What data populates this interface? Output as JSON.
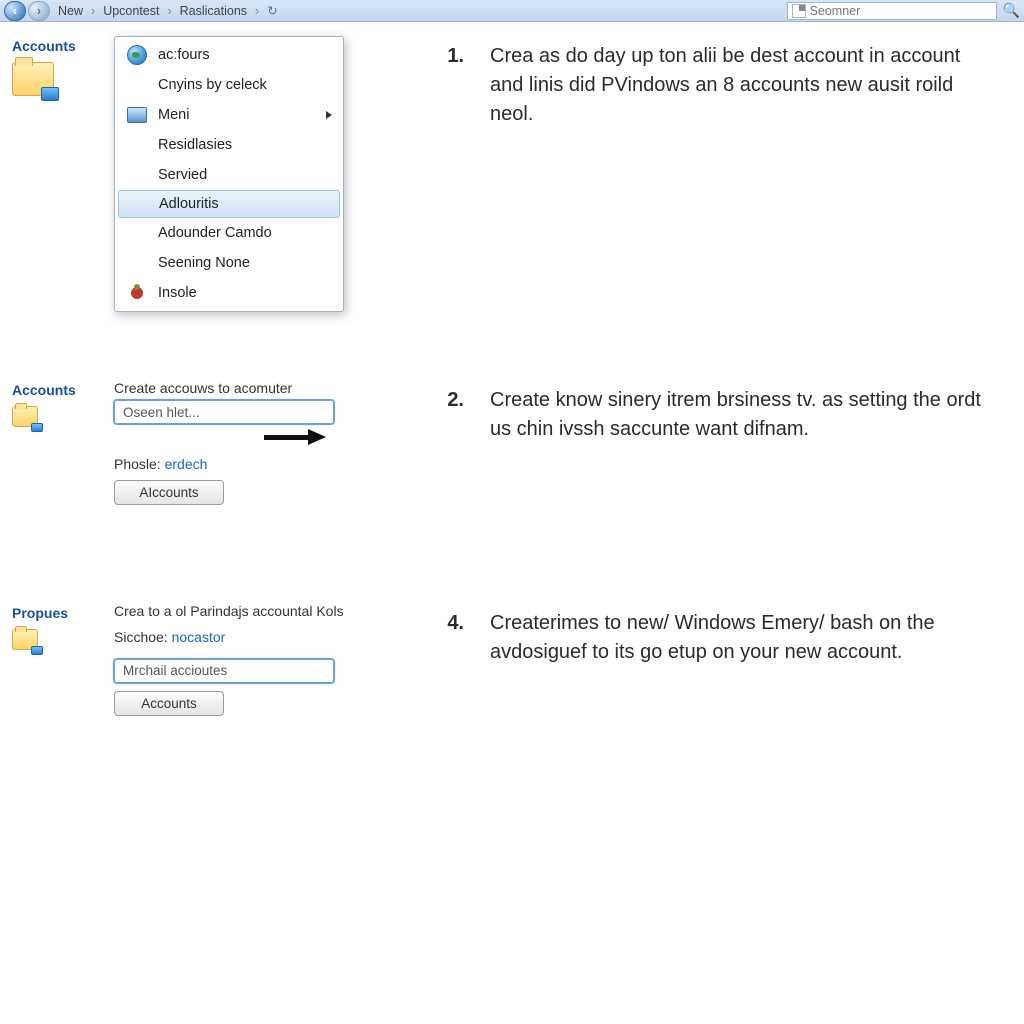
{
  "titlebar": {
    "crumbs": [
      "New",
      "Upcontest",
      "Raslications"
    ],
    "search_placeholder": "Seomner"
  },
  "step1": {
    "sidebar_caption": "Accounts",
    "menu": [
      {
        "label": "acːfours",
        "icon": "globe"
      },
      {
        "label": "Cnyins by celeck",
        "icon": ""
      },
      {
        "label": "Meni",
        "icon": "app",
        "submenu": true
      },
      {
        "label": "Residlasies",
        "icon": ""
      },
      {
        "label": "Servied",
        "icon": ""
      },
      {
        "label": "Adlouritis",
        "icon": "",
        "hover": true
      },
      {
        "label": "Adounder Camdo",
        "icon": ""
      },
      {
        "label": "Seening None",
        "icon": ""
      },
      {
        "label": "Insole",
        "icon": "bug"
      }
    ],
    "num": "1.",
    "text": "Crea as do day up ton alii be dest account in account and linis did PVindows an 8 accounts new ausit roild neol."
  },
  "step2": {
    "sidebar_caption": "Accounts",
    "heading": "Create accouws to acomuter",
    "input_value": "Oseen hlet...",
    "phosle_label": "Phosle:",
    "phosle_value": "erdech",
    "button": "AIccounts",
    "num": "2.",
    "text": "Create know sinery itrem brsiness tv. as setting the ordt us chin ivssh saccunte want difnam."
  },
  "step4": {
    "sidebar_caption": "Propues",
    "heading": "Crea to a ol Parindajs accountal Kols",
    "sicchoe_label": "Sicchoe:",
    "sicchoe_value": "nocastor",
    "input_value": "Mrchail accioutes",
    "button": "Accounts",
    "num": "4.",
    "text": "Createrimes to new/ Windows Emery/ bash on the avdosiguef to its go etup on your new account."
  }
}
